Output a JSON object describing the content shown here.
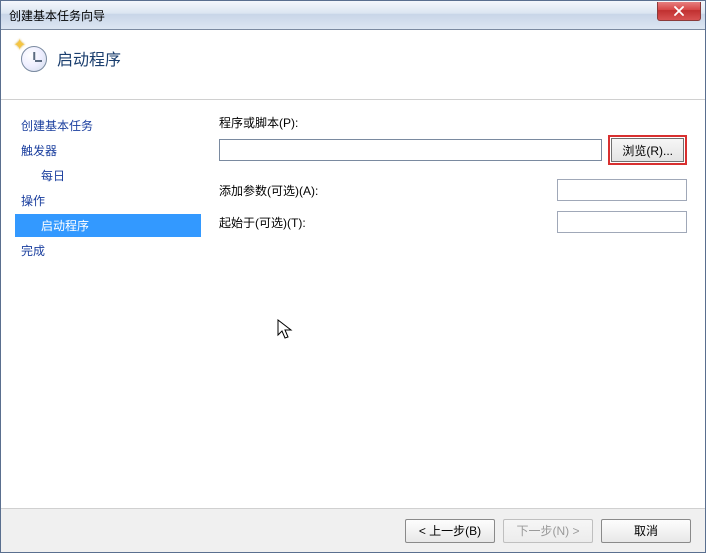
{
  "window": {
    "title": "创建基本任务向导"
  },
  "header": {
    "title": "启动程序"
  },
  "sidebar": {
    "items": [
      {
        "label": "创建基本任务",
        "kind": "top"
      },
      {
        "label": "触发器",
        "kind": "top"
      },
      {
        "label": "每日",
        "kind": "sub"
      },
      {
        "label": "操作",
        "kind": "top"
      },
      {
        "label": "启动程序",
        "kind": "selected"
      },
      {
        "label": "完成",
        "kind": "top"
      }
    ]
  },
  "form": {
    "program_label": "程序或脚本(P):",
    "program_value": "",
    "browse_label": "浏览(R)...",
    "args_label": "添加参数(可选)(A):",
    "args_value": "",
    "startin_label": "起始于(可选)(T):",
    "startin_value": ""
  },
  "footer": {
    "back": "< 上一步(B)",
    "next": "下一步(N) >",
    "cancel": "取消"
  }
}
